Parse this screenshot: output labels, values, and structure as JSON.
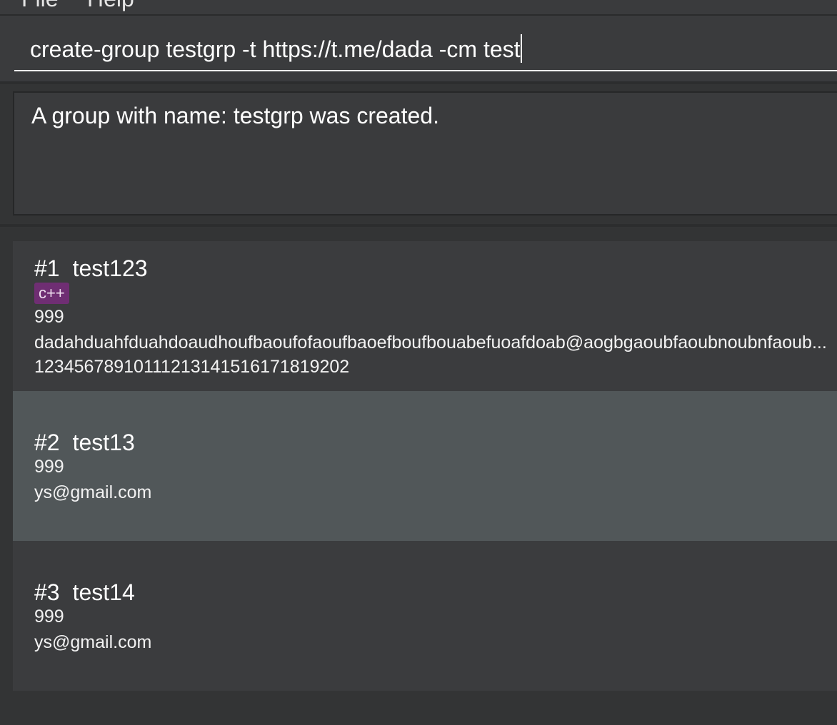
{
  "menu": {
    "file_label": "File",
    "help_label": "Help"
  },
  "command": {
    "value": "create-group testgrp -t https://t.me/dada -cm test"
  },
  "result": {
    "message": "A group with name: testgrp was created."
  },
  "persons": [
    {
      "index": "#1",
      "name": "test123",
      "tag": "c++",
      "phone": "999",
      "email": "dadahduahfduahdoaudhoufbaoufofaoufbaoefboufbouabefuoafdoab@aogbgaoubfaoubnoubnfaoub...",
      "telegram": "12345678910111213141516171819202"
    },
    {
      "index": "#2",
      "name": "test13",
      "phone": "999",
      "email": "ys@gmail.com"
    },
    {
      "index": "#3",
      "name": "test14",
      "phone": "999",
      "email": "ys@gmail.com"
    }
  ],
  "colors": {
    "background": "#333435",
    "panel": "#3a3b3d",
    "selected_card": "#515759",
    "tag": "#6f2e73"
  }
}
